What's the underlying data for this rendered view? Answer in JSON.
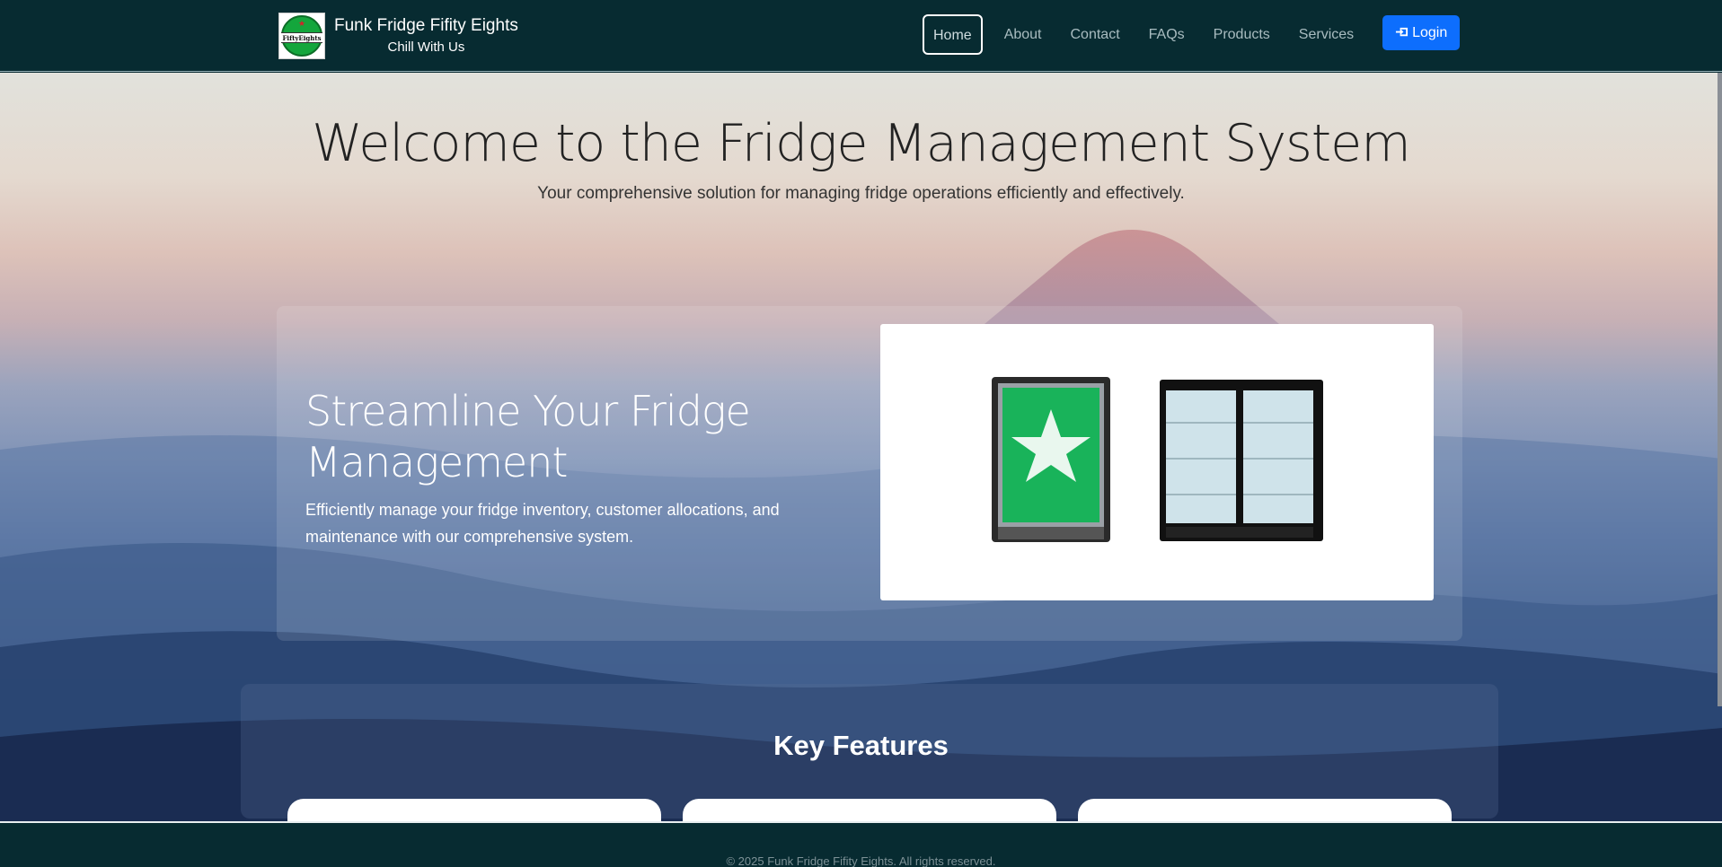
{
  "brand": {
    "name": "Funk Fridge Fifity Eights",
    "tagline": "Chill With Us",
    "logo_text": "FiftyEights"
  },
  "nav": {
    "items": [
      {
        "label": "Home"
      },
      {
        "label": "About"
      },
      {
        "label": "Contact"
      },
      {
        "label": "FAQs"
      },
      {
        "label": "Products"
      },
      {
        "label": "Services"
      }
    ],
    "login_label": "Login",
    "login_icon": "sign-in-icon"
  },
  "hero": {
    "title": "Welcome to the Fridge Management System",
    "subtitle": "Your comprehensive solution for managing fridge operations efficiently and effectively."
  },
  "feature_panel": {
    "heading": "Streamline Your Fridge Management",
    "text": "Efficiently manage your fridge inventory, customer allocations, and maintenance with our comprehensive system."
  },
  "key_features": {
    "heading": "Key Features"
  },
  "footer": {
    "copyright": "© 2025 Funk Fridge Fifity Eights. All rights reserved."
  },
  "colors": {
    "navbar": "#072b31",
    "accent": "#0d6efd"
  }
}
